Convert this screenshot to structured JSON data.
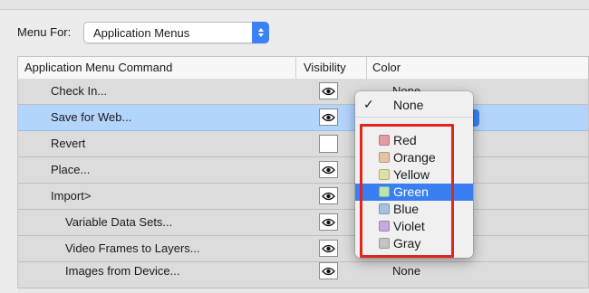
{
  "menu_for": {
    "label": "Menu For:",
    "selected": "Application Menus"
  },
  "table": {
    "headers": {
      "command": "Application Menu Command",
      "visibility": "Visibility",
      "color": "Color"
    },
    "rows": [
      {
        "command": "Check In...",
        "visible": true,
        "color": "None"
      },
      {
        "command": "Save for Web...",
        "visible": true,
        "color": ""
      },
      {
        "command": "Revert",
        "visible": false,
        "color": ""
      },
      {
        "command": "Place...",
        "visible": true,
        "color": ""
      },
      {
        "command": "Import>",
        "visible": true,
        "color": ""
      },
      {
        "command": "Variable Data Sets...",
        "visible": true,
        "color": ""
      },
      {
        "command": "Video Frames to Layers...",
        "visible": true,
        "color": ""
      },
      {
        "command": "Images from Device...",
        "visible": true,
        "color": "None"
      }
    ]
  },
  "color_popup": {
    "checked_item": "None",
    "highlighted_item": "Green",
    "items": [
      {
        "label": "None",
        "swatch": ""
      },
      {
        "label": "Red",
        "swatch": "#e89aa3"
      },
      {
        "label": "Orange",
        "swatch": "#e7c4a1"
      },
      {
        "label": "Yellow",
        "swatch": "#e0e0a3"
      },
      {
        "label": "Green",
        "swatch": "#b8e6b0"
      },
      {
        "label": "Blue",
        "swatch": "#a5c1e3"
      },
      {
        "label": "Violet",
        "swatch": "#c7a9e2"
      },
      {
        "label": "Gray",
        "swatch": "#c4c4c4"
      }
    ]
  },
  "annotation": {
    "box_color": "#e0271f"
  },
  "icons": {
    "visibility": "eye-icon",
    "stepper": "up-down-arrows-icon",
    "checkmark": "checkmark-icon"
  }
}
